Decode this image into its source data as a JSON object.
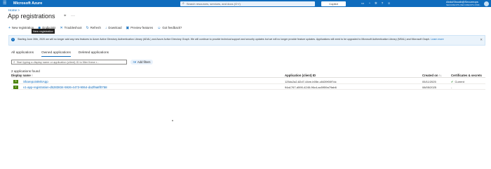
{
  "topbar": {
    "menu_glyph": "☰",
    "brand": "Microsoft Azure",
    "search_placeholder": "Search resources, services, and docs (G+/)",
    "copilot_label": "Copilot",
    "icons": [
      "terminal-icon",
      "bell-icon",
      "gear-icon",
      "help-icon",
      "feedback-icon"
    ],
    "user_name": "AbdulShoaib@Secureops",
    "user_directory": "SECUREOPS (SECUREOPS.ONM..."
  },
  "breadcrumb": "Home >",
  "page": {
    "title": "App registrations",
    "pin_glyph": "⌖",
    "more_glyph": "···"
  },
  "commands": [
    {
      "name": "new-registration",
      "icon": "+",
      "label": "New registration"
    },
    {
      "name": "endpoints",
      "icon": "◉",
      "label": "Endpoints"
    },
    {
      "name": "troubleshoot",
      "icon": "✕",
      "label": "Troubleshoot"
    },
    {
      "name": "refresh",
      "icon": "↻",
      "label": "Refresh"
    },
    {
      "name": "download",
      "icon": "↓",
      "label": "Download"
    },
    {
      "name": "preview-features",
      "icon": "▣",
      "label": "Preview features"
    },
    {
      "name": "got-feedback",
      "icon": "☺",
      "label": "Got feedback?"
    }
  ],
  "tooltip": "New registration",
  "banner": {
    "text": "Starting June 30th, 2020 we will no longer add any new features to Azure Active Directory Authentication Library (ADAL) and Azure Active Directory Graph. We will continue to provide technical support and security updates but we will no longer provide feature updates. Applications will need to be upgraded to Microsoft Authentication Library (MSAL) and Microsoft Graph.",
    "link": "Learn more",
    "close_glyph": "✕"
  },
  "tabs": [
    {
      "label": "All applications",
      "active": false
    },
    {
      "label": "Owned applications",
      "active": true
    },
    {
      "label": "Deleted applications",
      "active": false
    }
  ],
  "filter": {
    "placeholder": "Start typing a display name or application (client) ID to filter these r...",
    "add_filters_label": "Add filters"
  },
  "table": {
    "count_text": "2 applications found",
    "headers": {
      "display_name": "Display name ↑",
      "client_id": "Application (client) ID",
      "created_on": "Created on ↑↓",
      "certificates": "Certificates & secrets"
    },
    "rows": [
      {
        "avatar": "S",
        "name": "SharepointMSApp",
        "client_id": "125dc2a2-82d7-44ee-b05e-c8439f00f7dc",
        "created_on": "05/11/2025",
        "certificates": "Current",
        "status_icon": "check-circle-icon"
      },
      {
        "avatar": "v",
        "name": "v1-app-registration-d5283834-5926-4473-9064-da2f9a8f0758",
        "client_id": "94a1767-d590-4245-96c4-ac5959a79ab6",
        "created_on": "08/05/2025",
        "certificates": "-",
        "status_icon": ""
      }
    ]
  },
  "colors": {
    "topbar": "#0f6cbd",
    "accent": "#0f6cbd",
    "avatar": "#498205",
    "status_ok": "#107c10"
  }
}
